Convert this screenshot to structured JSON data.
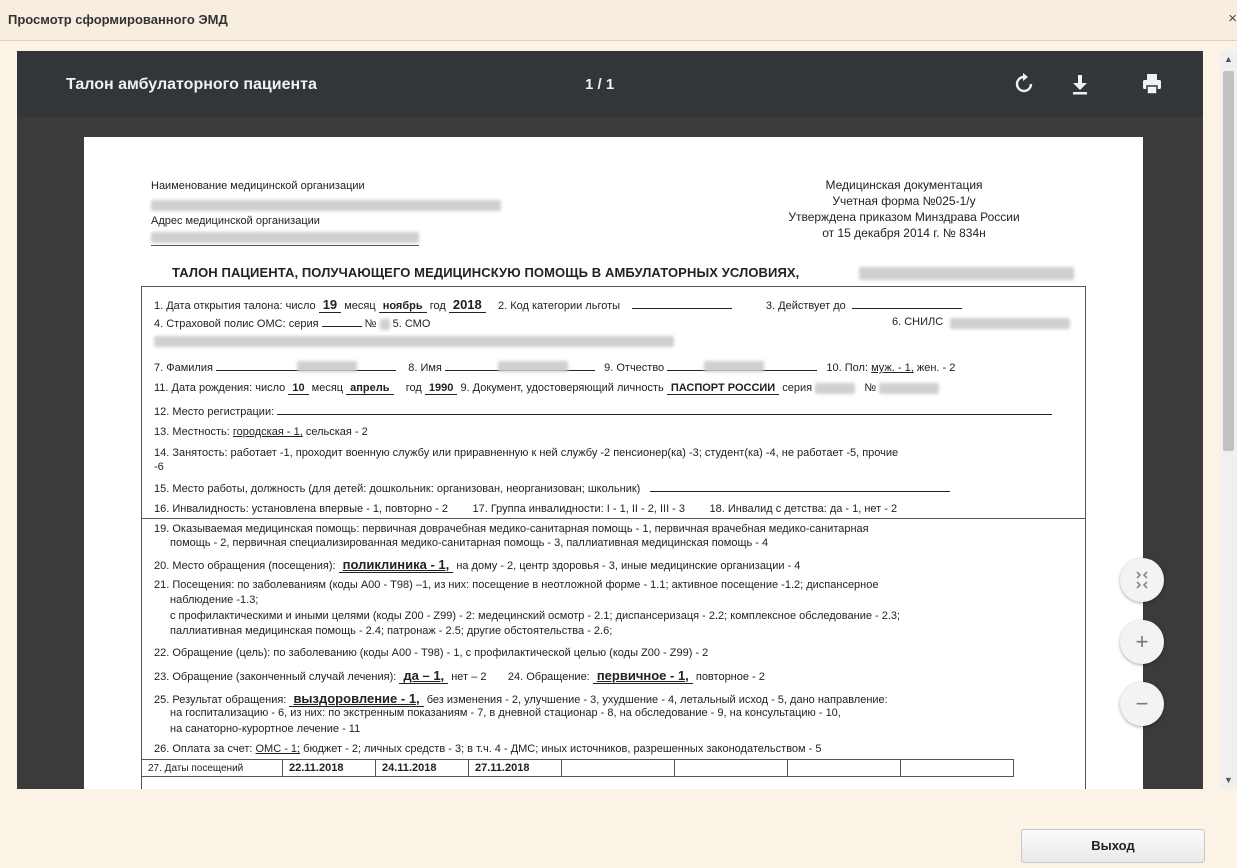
{
  "window": {
    "title": "Просмотр сформированного ЭМД",
    "close_label": "×"
  },
  "viewer": {
    "doc_title": "Талон амбулаторного пациента",
    "page_indicator": "1 / 1"
  },
  "icons": {
    "rotate": "rotate-icon",
    "download": "download-icon",
    "print": "print-icon",
    "fit": "fit-page-icon",
    "zoom_in": "zoom-in-icon",
    "zoom_out": "zoom-out-icon"
  },
  "doc": {
    "org_name_label": "Наименование медицинской организации",
    "org_address_label": "Адрес медицинской организации",
    "right_header": [
      "Медицинская документация",
      "Учетная форма №025-1/у",
      "Утверждена приказом Минздрава России",
      "от 15 декабря 2014 г. № 834н"
    ],
    "form_title": "ТАЛОН ПАЦИЕНТА, ПОЛУЧАЮЩЕГО МЕДИЦИНСКУЮ ПОМОЩЬ В АМБУЛАТОРНЫХ УСЛОВИЯХ,",
    "l1": {
      "a": "1. Дата открытия талона: число",
      "day": "19",
      "b": "месяц",
      "month": "ноябрь",
      "c": "год",
      "year": "2018",
      "d": "2. Код категории льготы",
      "e": "3. Действует до"
    },
    "l2": {
      "a": "4. Страховой полис ОМС: серия",
      "b": "№",
      "c": "5. СМО",
      "d": "6. СНИЛС"
    },
    "l3": {
      "a": "7. Фамилия",
      "b": "8. Имя",
      "c": "9. Отчество",
      "d": "10. Пол:",
      "male": "муж. - 1,",
      "female": "жен. - 2"
    },
    "l4": {
      "a": "11. Дата рождения: число",
      "day": "10",
      "b": "месяц",
      "month": "апрель",
      "c": "год",
      "year": "1990",
      "d": "9. Документ, удостоверяющий личность",
      "doc": "ПАСПОРТ РОССИИ",
      "e": "серия",
      "f": "№"
    },
    "l5": "12. Место регистрации:",
    "l6": {
      "a": "13. Местность:",
      "u": "городская - 1,",
      "b": "сельская - 2"
    },
    "l7a": "14. Занятость: работает -1, проходит военную службу или приравненную к ней службу -2 пенсионер(ка) -3; студент(ка) -4, не работает -5, прочие",
    "l7b": "-6",
    "l8": "15. Место работы, должность (для детей: дошкольник: организован, неорганизован; школьник)",
    "l9": {
      "a": "16. Инвалидность: установлена впервые - 1, повторно - 2",
      "b": "17. Группа инвалидности: I - 1, II - 2, III - 3",
      "c": "18. Инвалид с детства: да - 1, нет - 2"
    },
    "l10a": "19. Оказываемая медицинская помощь: первичная доврачебная медико-санитарная помощь - 1, первичная врачебная медико-санитарная",
    "l10b": "помощь - 2, первичная специализированная медико-санитарная помощь - 3, паллиативная медицинская помощь - 4",
    "l11": {
      "a": "20. Место обращения (посещения):",
      "u": "поликлиника - 1,",
      "b": "на дому - 2,  центр здоровья - 3, иные медицинские организации - 4"
    },
    "l12a": "21. Посещения: по заболеваниям (коды А00 - Т98) –1,  из них: посещение в неотложной форме - 1.1; активное посещение -1.2;  диспансерное",
    "l12b": "наблюдение -1.3;",
    "l12c": "с профилактическими и иными целями (коды Z00 - Z99) - 2: медецинский осмотр - 2.1;  диспансеризаця - 2.2;  комплексное обследование - 2.3;",
    "l12d": "паллиативная медицинская помощь - 2.4; патронаж - 2.5;  другие обстоятельства - 2.6;",
    "l13": "22. Обращение (цель): по заболеванию (коды А00 - Т98) - 1,  с профилактической целью (коды Z00 - Z99) - 2",
    "l14": {
      "a": "23. Обращение (законченный случай лечения):",
      "u1": "да – 1,",
      "b": "нет – 2",
      "c": "24. Обращение:",
      "u2": "первичное - 1,",
      "d": "повторное - 2"
    },
    "l15": {
      "a": "25. Результат обращения:",
      "u": "выздоровление - 1,",
      "b": "без изменения - 2, улучшение - 3, ухудшение - 4, летальный исход - 5, дано направление:"
    },
    "l15b": "на госпитализацию - 6, из них: по экстренным показаниям - 7, в дневной стационар - 8, на обследование - 9, на консультацию - 10,",
    "l15c": "на санаторно-курортное лечение - 11",
    "l16": {
      "a": "26. Оплата за счет:",
      "u": "ОМС - 1;",
      "b": "бюджет - 2; личных средств - 3; в т.ч. 4 - ДМС; иных источников, разрешенных законодательством - 5"
    },
    "visits": [
      "27. Даты посещений",
      "22.11.2018",
      "24.11.2018",
      "27.11.2018"
    ]
  },
  "footer": {
    "exit_label": "Выход"
  }
}
